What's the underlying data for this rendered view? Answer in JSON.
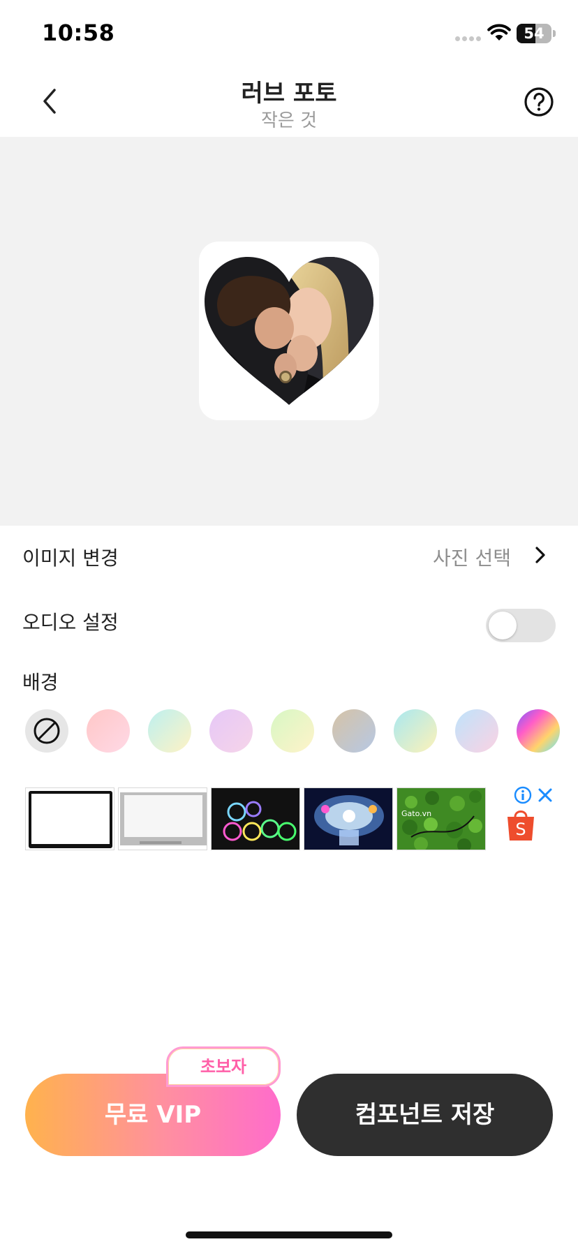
{
  "status_bar": {
    "time": "10:58",
    "battery_level": "54",
    "battery_fraction": 0.54
  },
  "header": {
    "title": "러브 포토",
    "subtitle": "작은 것"
  },
  "preview": {
    "shape": "heart",
    "description_icon": "heart-photo"
  },
  "settings": {
    "change_image_label": "이미지 변경",
    "change_image_value": "사진 선택",
    "audio_label": "오디오 설정",
    "audio_enabled": false,
    "background_label": "배경"
  },
  "swatches": [
    {
      "name": "none",
      "colors": [
        "#e6e6e6"
      ]
    },
    {
      "name": "pink",
      "colors": [
        "#ffc7c7",
        "#ffd9e6"
      ]
    },
    {
      "name": "mint-yellow",
      "colors": [
        "#bdf0f0",
        "#fff3c4"
      ]
    },
    {
      "name": "lavender",
      "colors": [
        "#e6c8f7",
        "#f6d4e9"
      ]
    },
    {
      "name": "lime",
      "colors": [
        "#d7f7c4",
        "#fff3c9"
      ]
    },
    {
      "name": "sand-blue",
      "colors": [
        "#d6c3a6",
        "#b6c8e4"
      ]
    },
    {
      "name": "aqua-yellow",
      "colors": [
        "#a9e8f0",
        "#fdf2b8"
      ]
    },
    {
      "name": "sky-pink",
      "colors": [
        "#bfe3fb",
        "#fbd2e3"
      ]
    },
    {
      "name": "rainbow",
      "colors": [
        "#7c5bff",
        "#ff5cc8",
        "#ffd46b",
        "#62e2ff"
      ]
    },
    {
      "name": "violet",
      "colors": [
        "#b9a6ff",
        "#e0d6ff"
      ]
    }
  ],
  "ad": {
    "thumbnails": [
      "laptop-screen-panel",
      "laptop-screen-white",
      "rgb-led-rings",
      "rgb-cooling-fan",
      "green-grass-mat"
    ],
    "watermark": "Gato.vn",
    "shop_icon_letter": "S"
  },
  "buttons": {
    "vip_label": "무료 VIP",
    "beginner_badge": "초보자",
    "save_label": "컴포넌트 저장"
  },
  "colors": {
    "vip_gradient_start": "#ffb24d",
    "vip_gradient_end": "#ff6ccb",
    "save_button": "#2f2f2f",
    "badge_text": "#ff5fa8",
    "ad_shop_orange": "#ee4d2d",
    "ad_info_blue": "#1a8cff"
  }
}
